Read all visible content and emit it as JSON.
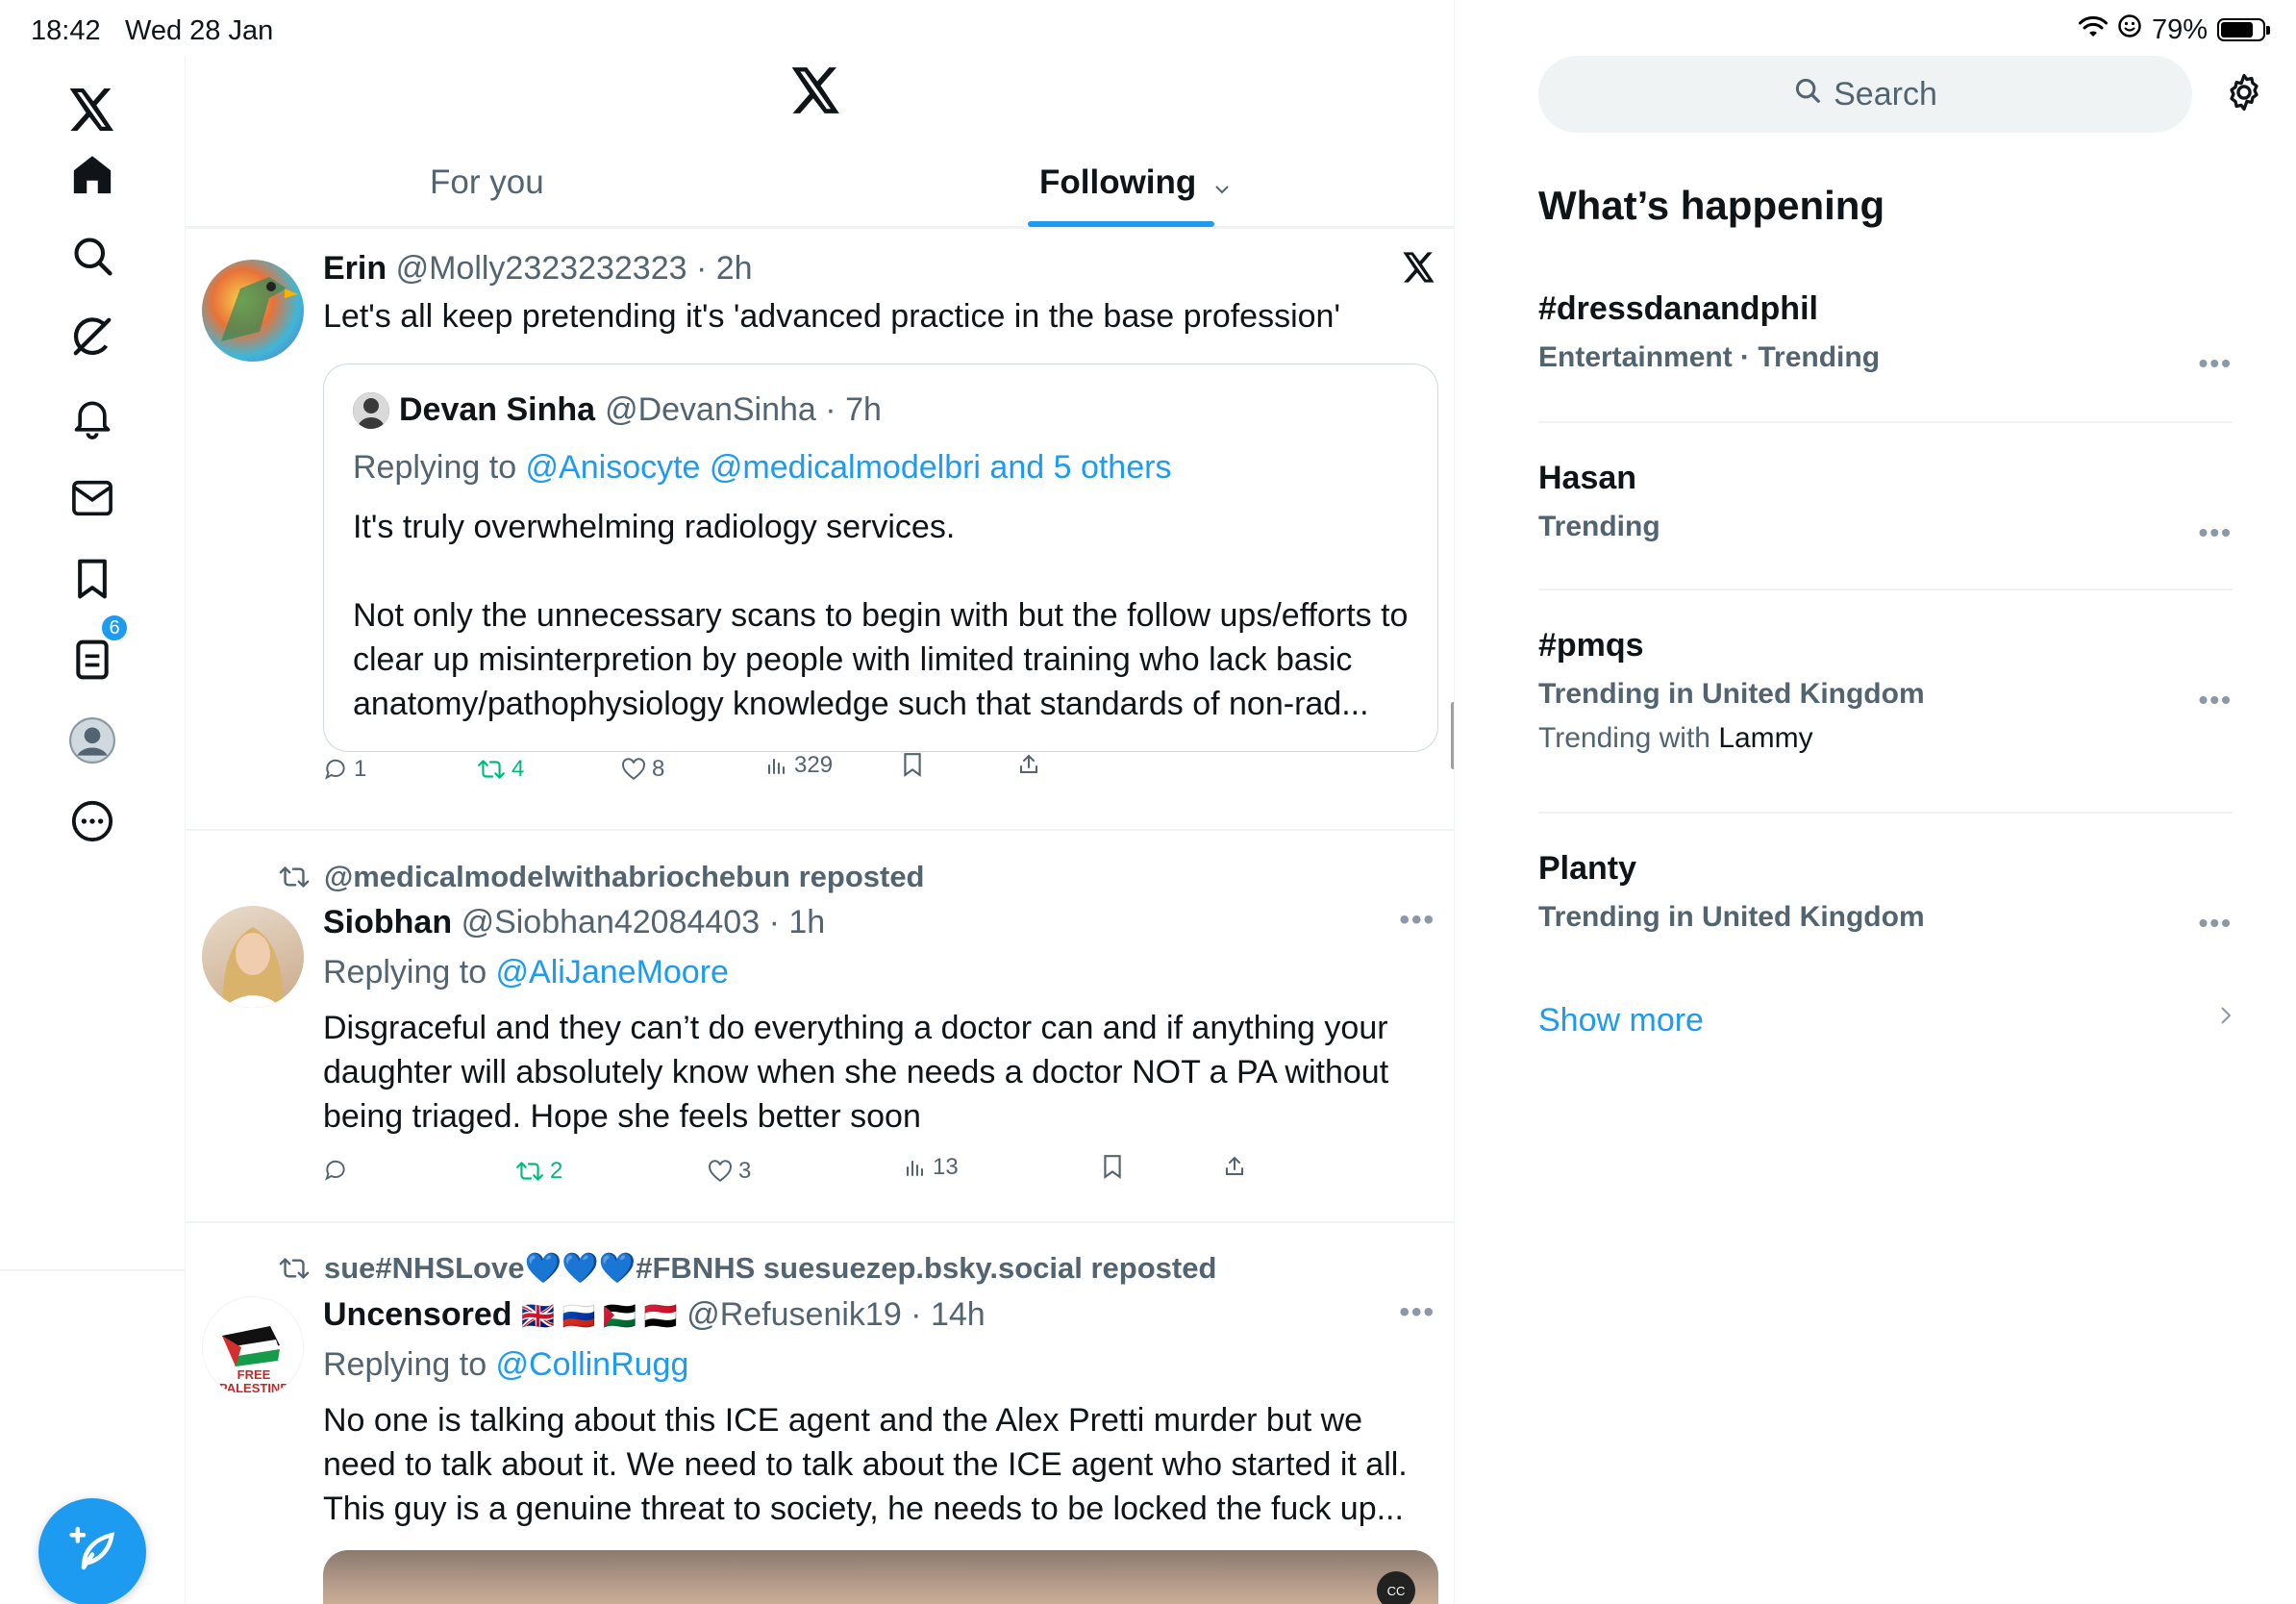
{
  "status_bar": {
    "time": "18:42",
    "date": "Wed 28 Jan",
    "battery": "79%"
  },
  "sidebar": {
    "items": [
      {
        "name": "x-logo-icon"
      },
      {
        "name": "home-icon"
      },
      {
        "name": "search-icon"
      },
      {
        "name": "grok-icon"
      },
      {
        "name": "notifications-icon",
        "badge": "6"
      },
      {
        "name": "messages-icon"
      },
      {
        "name": "bookmarks-icon"
      },
      {
        "name": "lists-icon"
      },
      {
        "name": "profile-icon"
      },
      {
        "name": "more-icon"
      }
    ],
    "compose_icon": "compose-feather-icon"
  },
  "header": {
    "tabs": [
      {
        "label": "For you",
        "active": false
      },
      {
        "label": "Following",
        "active": true
      }
    ]
  },
  "tweets": [
    {
      "name": "Erin",
      "handle": "@Molly2323232323",
      "time": "2h",
      "text": "Let's all keep pretending it's 'advanced practice in the base profession'",
      "quote": {
        "name": "Devan Sinha",
        "handle": "@DevanSinha",
        "time": "7h",
        "reply_prefix": "Replying to ",
        "reply_to": "@Anisocyte @medicalmodelbri and 5 others",
        "text_p1": "It's truly overwhelming radiology services.",
        "text_p2": "Not only the unnecessary scans to begin with but the follow ups/efforts to clear up misinterpretion by people with limited training who lack basic anatomy/pathophysiology knowledge such that standards of non-rad..."
      },
      "stats": {
        "replies": "1",
        "reposts": "4",
        "likes": "8",
        "views": "329"
      }
    },
    {
      "reposted_by": "@medicalmodelwithabriochebun reposted",
      "name": "Siobhan",
      "handle": "@Siobhan42084403",
      "time": "1h",
      "reply_prefix": "Replying to ",
      "reply_to": "@AliJaneMoore",
      "text": "Disgraceful and they can’t do everything a doctor can and if anything your daughter will absolutely know when she needs a doctor NOT a PA without being triaged. Hope she feels better soon",
      "stats": {
        "replies": "",
        "reposts": "2",
        "likes": "3",
        "views": "13"
      }
    },
    {
      "reposted_by": "sue#NHSLove💙💙💙#FBNHS suesuezep.bsky.social reposted",
      "name": "Uncensored",
      "flags": "🇬🇧 🇷🇺 🇵🇸 🇾🇪",
      "handle": "@Refusenik19",
      "time": "14h",
      "reply_prefix": "Replying to ",
      "reply_to": "@CollinRugg",
      "text": "No one is talking about this ICE agent and the Alex Pretti murder but we need to talk about it. We need to talk about the ICE agent who started it all. This guy is a genuine threat to society, he needs to be locked the fuck up...",
      "avatar_text": "FREE PALESTINE",
      "media_badge": "CC"
    }
  ],
  "right": {
    "search_placeholder": "Search",
    "section_title": "What’s happening",
    "trends": [
      {
        "name": "#dressdanandphil",
        "meta": "Entertainment · Trending"
      },
      {
        "name": "Hasan",
        "meta": "Trending"
      },
      {
        "name": "#pmqs",
        "meta": "Trending in United Kingdom",
        "with_prefix": "Trending with ",
        "with": "Lammy"
      },
      {
        "name": "Planty",
        "meta": "Trending in United Kingdom"
      }
    ],
    "show_more": "Show more"
  },
  "colors": {
    "accent": "#1d9bf0",
    "repost_green": "#00ba7c",
    "secondary_text": "#536471",
    "border": "#eff3f4"
  }
}
